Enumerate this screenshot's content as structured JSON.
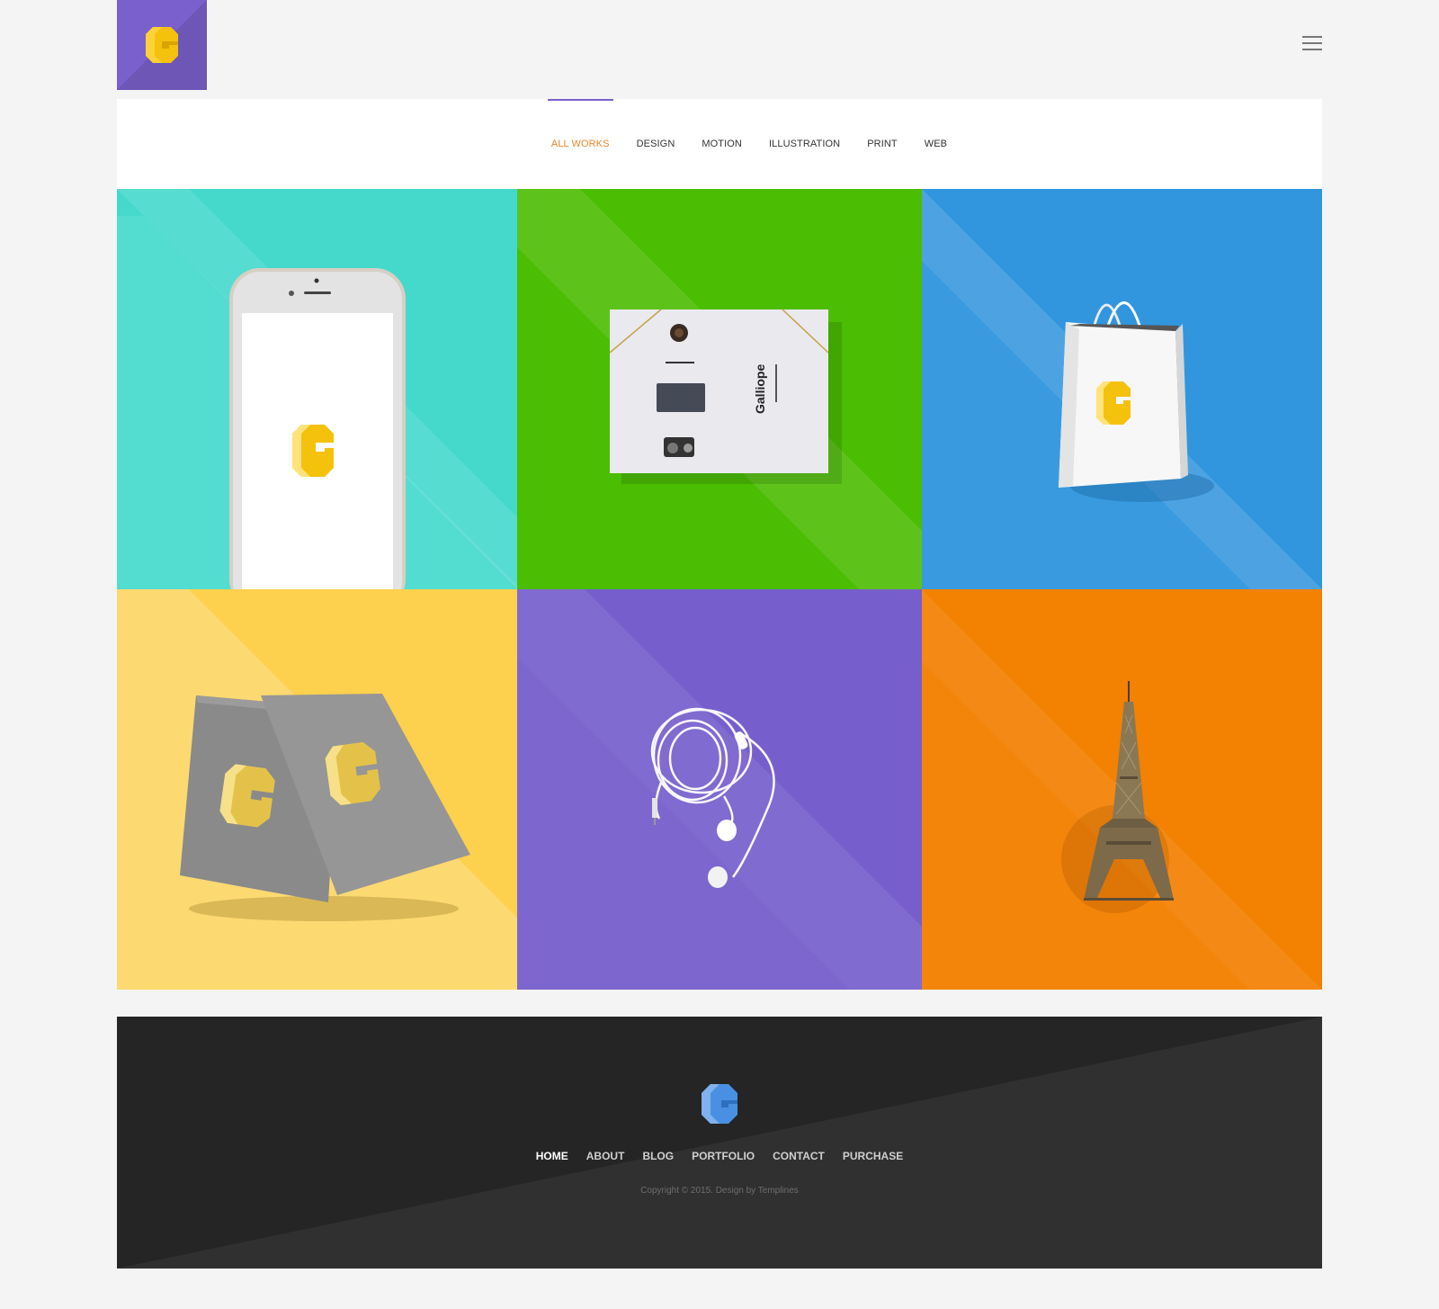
{
  "header": {
    "logo_color": "#7a60cc",
    "logo_mark_color": "#f4c20d",
    "menu_icon": "hamburger-icon"
  },
  "filters": {
    "items": [
      "ALL WORKS",
      "DESIGN",
      "MOTION",
      "ILLUSTRATION",
      "PRINT",
      "WEB"
    ],
    "active_index": 0,
    "active_color": "#e8872b",
    "indicator_color": "#7a60cc"
  },
  "portfolio": {
    "items": [
      {
        "subject": "phone-mockup",
        "color": "#45d9cc"
      },
      {
        "subject": "stationery-mockup",
        "color": "#4bbd02",
        "printed_text": "Galliope"
      },
      {
        "subject": "shopping-bag",
        "color": "#3196de"
      },
      {
        "subject": "business-cards",
        "color": "#fdd04e"
      },
      {
        "subject": "earphones",
        "color": "#765fcc"
      },
      {
        "subject": "eiffel-tower",
        "color": "#f38102"
      }
    ]
  },
  "footer": {
    "logo_color": "#4a90e2",
    "nav": [
      "HOME",
      "ABOUT",
      "BLOG",
      "PORTFOLIO",
      "CONTACT",
      "PURCHASE"
    ],
    "active_index": 0,
    "copyright": "Copyright © 2015. Design by Templines"
  }
}
